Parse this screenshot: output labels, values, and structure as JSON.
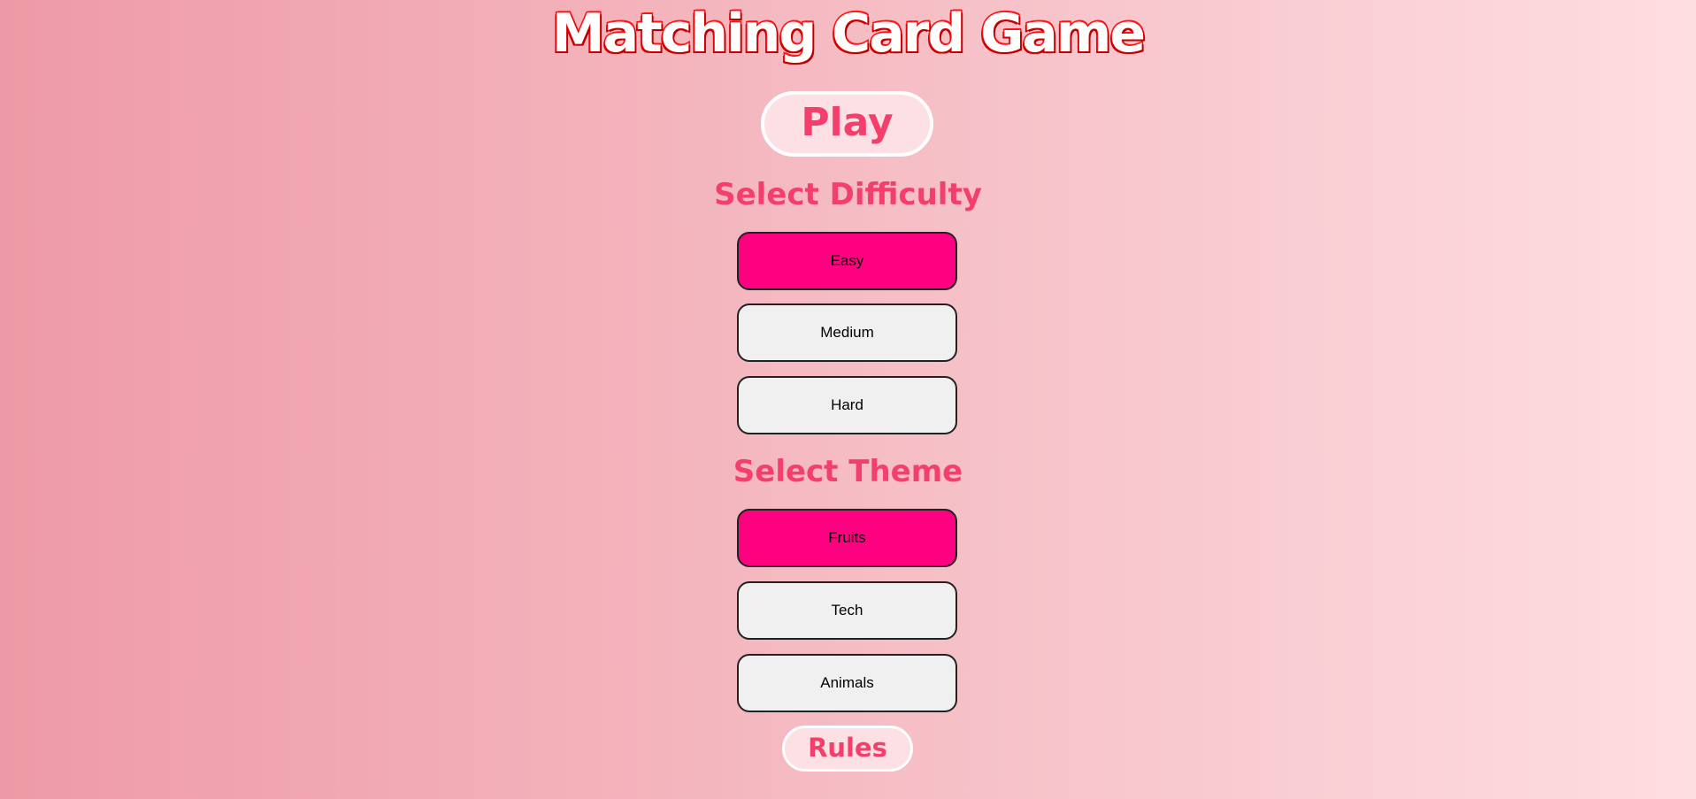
{
  "app": {
    "title": "Matching Card Game"
  },
  "menu": {
    "play_label": "Play",
    "rules_label": "Rules"
  },
  "difficulty": {
    "heading": "Select Difficulty",
    "options": [
      {
        "label": "Easy",
        "selected": true
      },
      {
        "label": "Medium",
        "selected": false
      },
      {
        "label": "Hard",
        "selected": false
      }
    ]
  },
  "theme": {
    "heading": "Select Theme",
    "options": [
      {
        "label": "Fruits",
        "selected": true
      },
      {
        "label": "Tech",
        "selected": false
      },
      {
        "label": "Animals",
        "selected": false
      }
    ]
  },
  "colors": {
    "accent": "#f43f6c",
    "selected": "#ff0080",
    "title_outline": "#ff0000",
    "button_bg": "#f0f0f0"
  }
}
